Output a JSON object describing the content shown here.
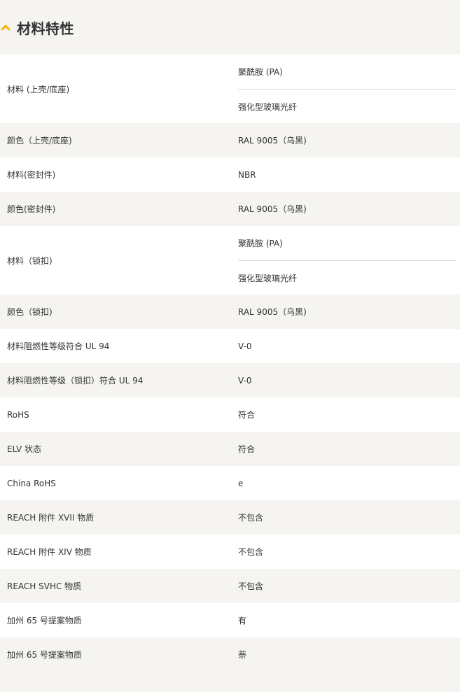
{
  "section": {
    "title": "材料特性",
    "accent_color": "#f4b400",
    "toggle_icon": "chevron-up-icon"
  },
  "rows": [
    {
      "label": "材料 (上壳/底座)",
      "values": [
        "聚酰胺 (PA)",
        "强化型玻璃光纤"
      ]
    },
    {
      "label": "颜色（上壳/底座)",
      "values": [
        "RAL 9005（乌黑)"
      ]
    },
    {
      "label": "材料(密封件)",
      "values": [
        "NBR"
      ]
    },
    {
      "label": "颜色(密封件)",
      "values": [
        "RAL 9005（乌黑)"
      ]
    },
    {
      "label": "材料（锁扣)",
      "values": [
        "聚酰胺 (PA)",
        "强化型玻璃光纤"
      ]
    },
    {
      "label": "颜色（锁扣)",
      "values": [
        "RAL 9005（乌黑)"
      ]
    },
    {
      "label": "材料阻燃性等级符合 UL 94",
      "values": [
        "V-0"
      ]
    },
    {
      "label": "材料阻燃性等级（锁扣）符合 UL 94",
      "values": [
        "V-0"
      ]
    },
    {
      "label": "RoHS",
      "values": [
        "符合"
      ]
    },
    {
      "label": "ELV 状态",
      "values": [
        "符合"
      ]
    },
    {
      "label": "China RoHS",
      "values": [
        "e"
      ]
    },
    {
      "label": "REACH 附件 XVII 物质",
      "values": [
        "不包含"
      ]
    },
    {
      "label": "REACH 附件 XIV 物质",
      "values": [
        "不包含"
      ]
    },
    {
      "label": "REACH SVHC 物质",
      "values": [
        "不包含"
      ]
    },
    {
      "label": "加州 65 号提案物质",
      "values": [
        "有"
      ]
    },
    {
      "label": "加州 65 号提案物质",
      "values": [
        "萘"
      ]
    }
  ]
}
